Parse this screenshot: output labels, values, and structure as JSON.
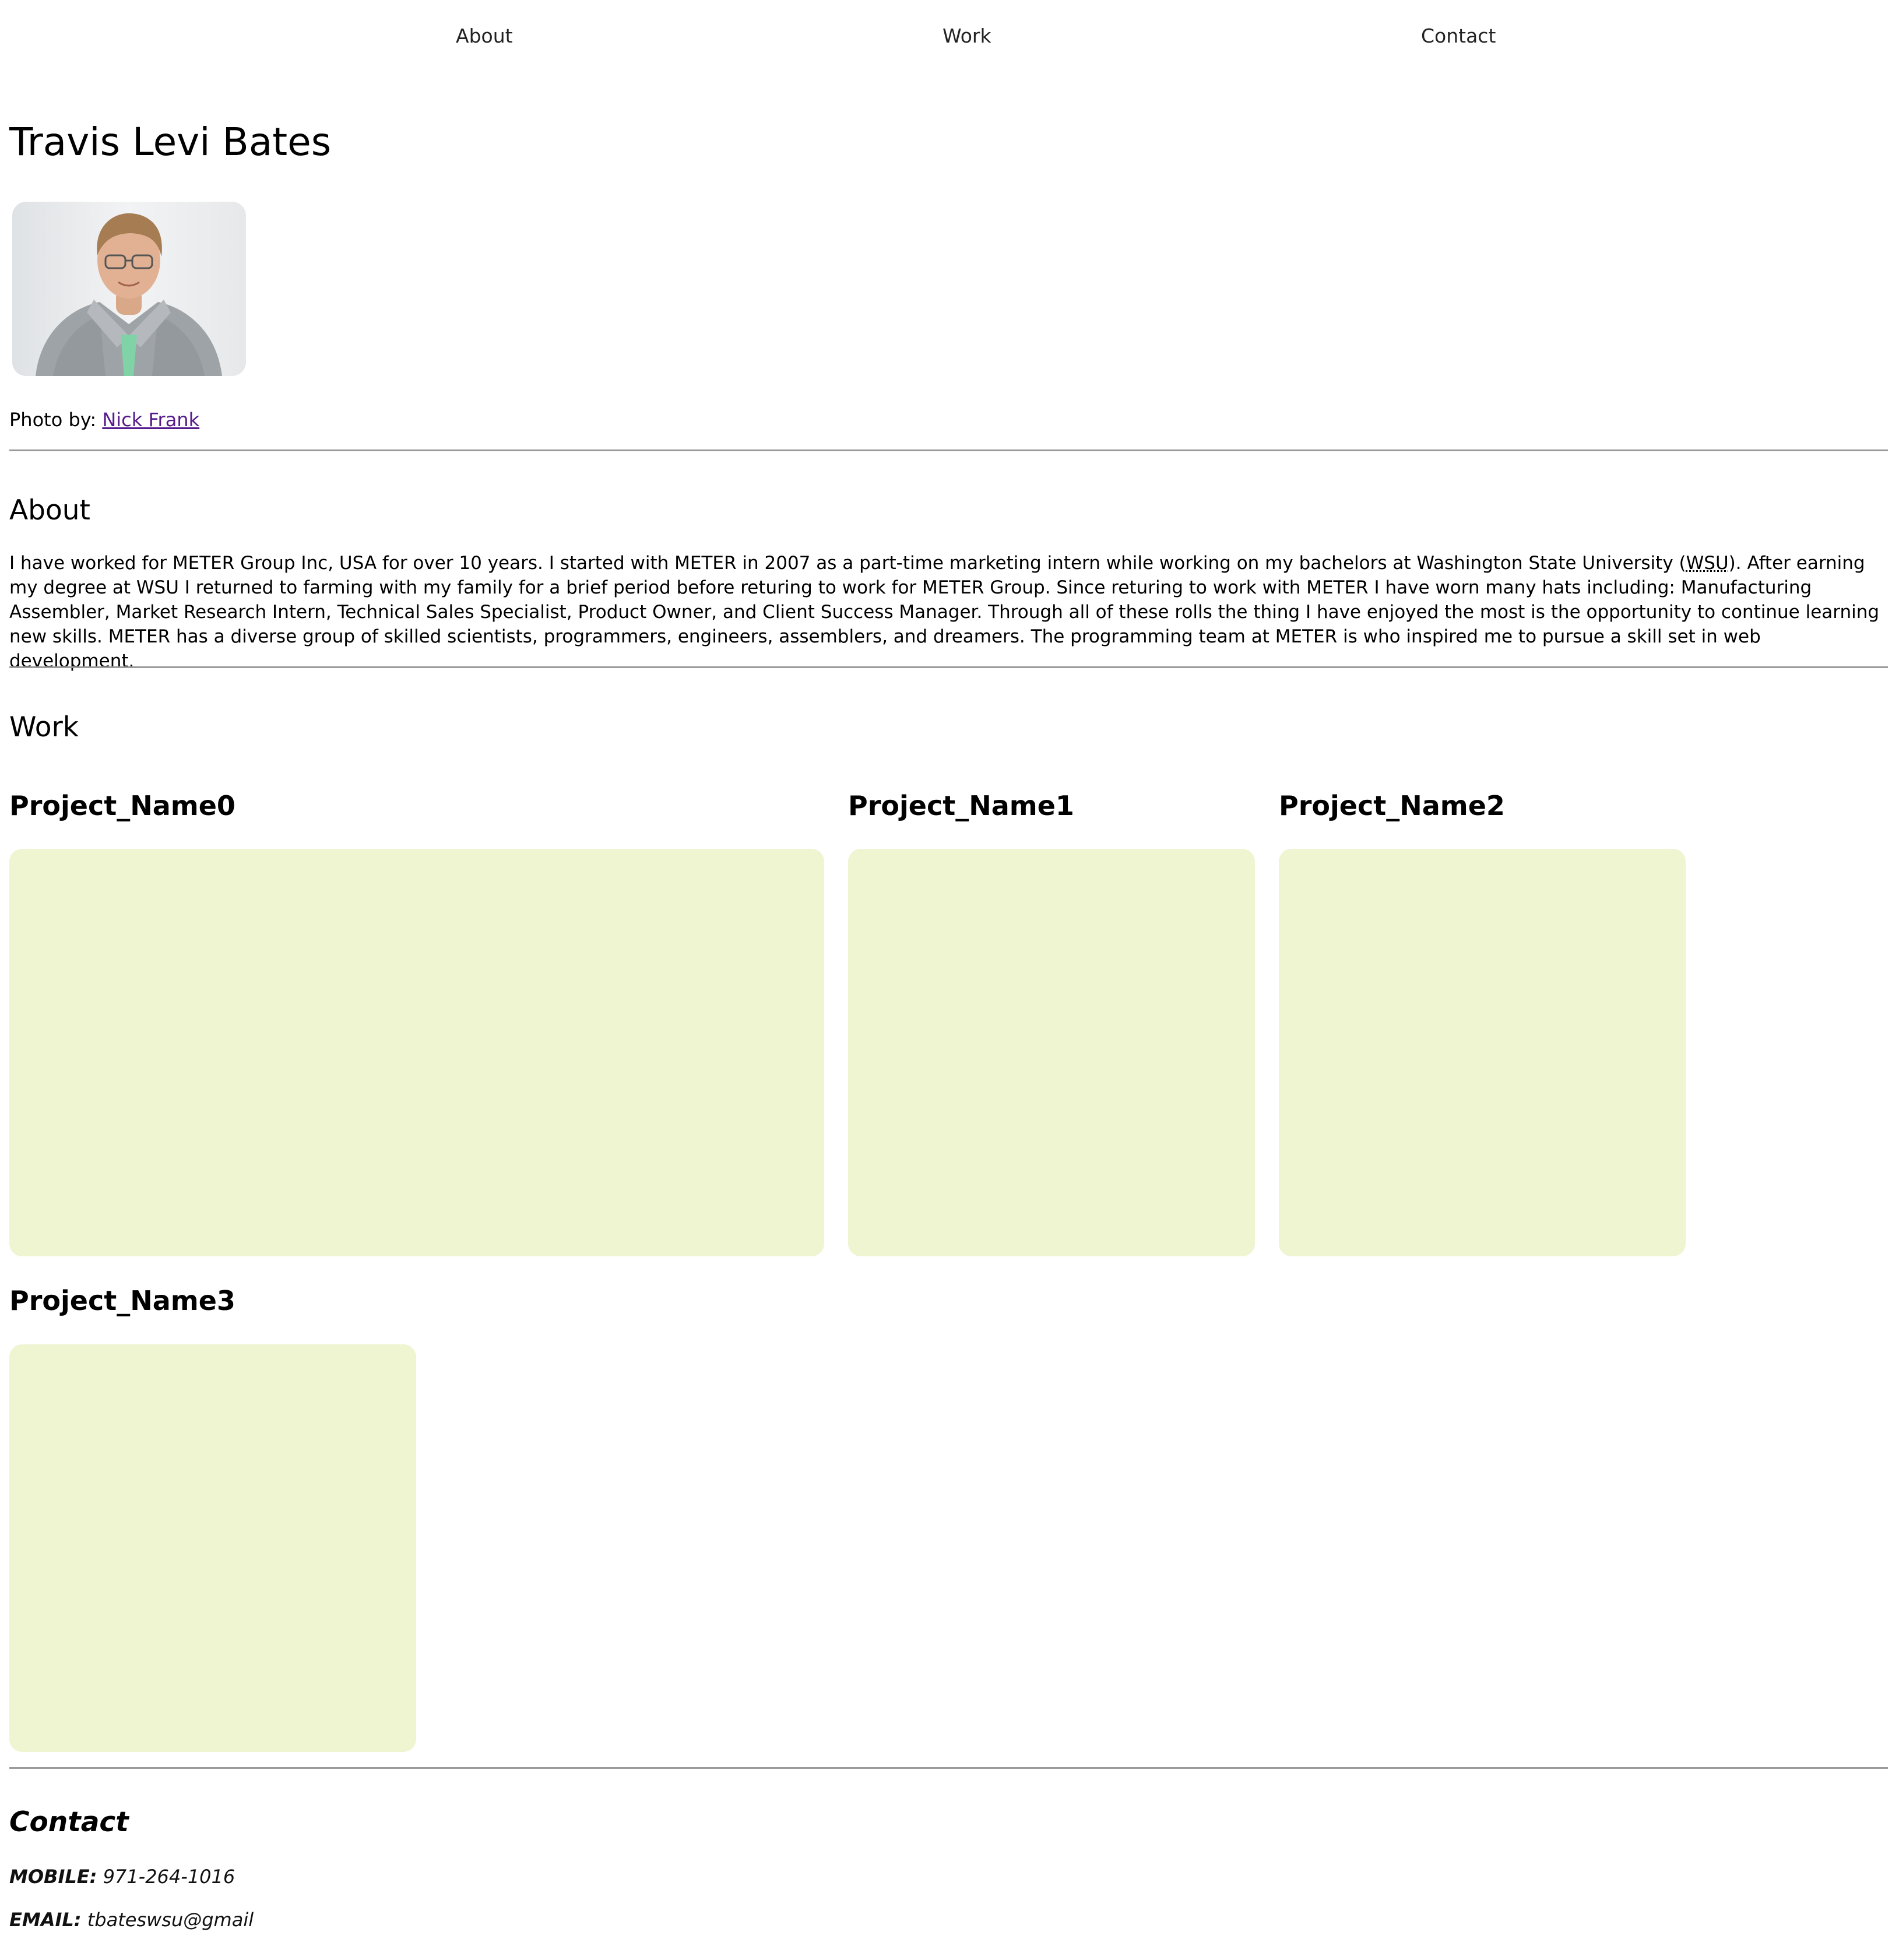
{
  "nav": {
    "items": [
      "About",
      "Work",
      "Contact"
    ]
  },
  "header": {
    "name": "Travis Levi Bates"
  },
  "photo": {
    "credit_label": "Photo by:",
    "credit_name": "Nick Frank"
  },
  "about": {
    "heading": "About",
    "text_before_abbr": "I have worked for METER Group Inc, USA for over 10 years. I started with METER in 2007 as a part-time marketing intern while working on my bachelors at Washington State University (",
    "abbr": "WSU",
    "text_after_abbr": "). After earning my degree at WSU I returned to farming with my family for a brief period before returing to work for METER Group. Since returing to work with METER I have worn many hats including: Manufacturing Assembler, Market Research Intern, Technical Sales Specialist, Product Owner, and Client Success Manager. Through all of these rolls the thing I have enjoyed the most is the opportunity to continue learning new skills. METER has a diverse group of skilled scientists, programmers, engineers, assemblers, and dreamers. The programming team at METER is who inspired me to pursue a skill set in web development."
  },
  "work": {
    "heading": "Work",
    "projects": [
      {
        "title": "Project_Name0"
      },
      {
        "title": "Project_Name1"
      },
      {
        "title": "Project_Name2"
      },
      {
        "title": "Project_Name3"
      }
    ]
  },
  "contact": {
    "heading": "Contact",
    "mobile_label": "MOBILE:",
    "mobile_value": "971-264-1016",
    "email_label": "EMAIL:",
    "email_value": "tbateswsu@gmail"
  },
  "colors": {
    "project_box": "#eff4d1",
    "link_visited": "#551a8b",
    "rule": "#9a9a9a"
  }
}
